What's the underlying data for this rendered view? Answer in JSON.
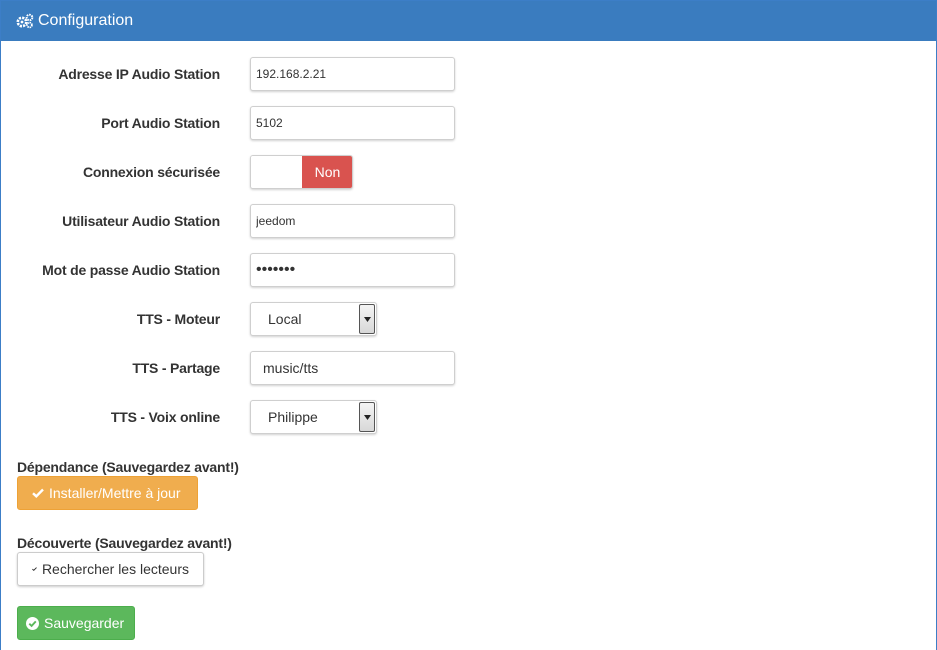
{
  "header": {
    "title": "Configuration",
    "icon": "cogs-icon"
  },
  "form": {
    "ip": {
      "label": "Adresse IP Audio Station",
      "value": "192.168.2.21"
    },
    "port": {
      "label": "Port Audio Station",
      "value": "5102"
    },
    "secure": {
      "label": "Connexion sécurisée",
      "state": "Non"
    },
    "user": {
      "label": "Utilisateur Audio Station",
      "value": "jeedom"
    },
    "password": {
      "label": "Mot de passe Audio Station",
      "value": "•••••••"
    },
    "tts_engine": {
      "label": "TTS - Moteur",
      "value": "Local"
    },
    "tts_share": {
      "label": "TTS - Partage",
      "value": "music/tts"
    },
    "tts_voice": {
      "label": "TTS - Voix online",
      "value": "Philippe"
    }
  },
  "dependency": {
    "title": "Dépendance (Sauvegardez avant!)",
    "button": "Installer/Mettre à jour"
  },
  "discovery": {
    "title": "Découverte (Sauvegardez avant!)",
    "button": "Rechercher les lecteurs"
  },
  "save": {
    "button": "Sauvegarder"
  },
  "colors": {
    "header": "#3a7cbf",
    "off": "#d9534f",
    "warning": "#f0ad4e",
    "success": "#5cb85c"
  }
}
